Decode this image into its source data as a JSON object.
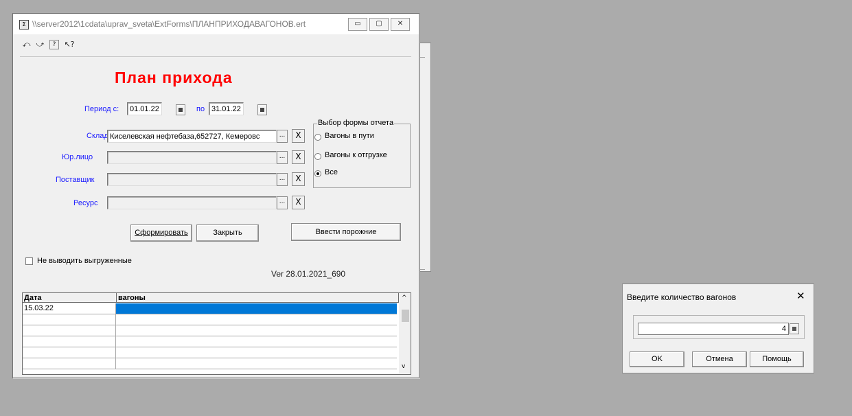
{
  "main_window": {
    "title": "\\\\server2012\\1cdata\\uprav_sveta\\ExtForms\\ПЛАНПРИХОДАВАГОНОВ.ert",
    "controls": {
      "minimize": "▭",
      "maximize": "▢",
      "close": "✕"
    },
    "app_icon": "Σ"
  },
  "toolbar": {
    "icons": [
      "undo-icon",
      "redo-icon",
      "help-icon",
      "context-help-icon"
    ],
    "glyphs": [
      "⤺",
      "⤻",
      "?",
      "↖?"
    ]
  },
  "form": {
    "title": "План прихода",
    "period_label": "Период с:",
    "period_from": "01.01.22",
    "period_to_label": "по",
    "period_to": "31.01.22",
    "warehouse_label": "Склад",
    "warehouse_value": "Киселевская нефтебаза,652727, Кемеровс",
    "legal_entity_label": "Юр.лицо",
    "legal_entity_value": "",
    "supplier_label": "Поставщик",
    "supplier_value": "",
    "resource_label": "Ресурс",
    "resource_value": "",
    "ellipsis": "...",
    "clear": "X",
    "report_group_title": "Выбор формы отчета",
    "report_options": [
      {
        "label": "Вагоны в пути",
        "selected": false
      },
      {
        "label": "Вагоны к отгрузке",
        "selected": false
      },
      {
        "label": "Все",
        "selected": true
      }
    ],
    "generate_button": "Сформировать",
    "close_button": "Закрыть",
    "enter_empty_button": "Ввести порожние",
    "hide_unloaded_label": "Не выводить выгруженные",
    "hide_unloaded_checked": false,
    "version": "Ver 28.01.2021_690"
  },
  "grid": {
    "columns": [
      "Дата",
      "вагоны"
    ],
    "rows": [
      [
        "15.03.22",
        ""
      ],
      [
        "",
        ""
      ],
      [
        "",
        ""
      ],
      [
        "",
        ""
      ],
      [
        "",
        ""
      ],
      [
        "",
        ""
      ]
    ],
    "scroll_up": "^",
    "scroll_down": "v"
  },
  "dialog": {
    "title": "Введите количество вагонов",
    "close": "✕",
    "value": "4",
    "ok_button": "OK",
    "cancel_button": "Отмена",
    "help_button": "Помощь"
  },
  "colors": {
    "title_red": "#ff0000",
    "label_blue": "#1a1aff",
    "selection_blue": "#0078d7",
    "desktop": "#ababab"
  }
}
